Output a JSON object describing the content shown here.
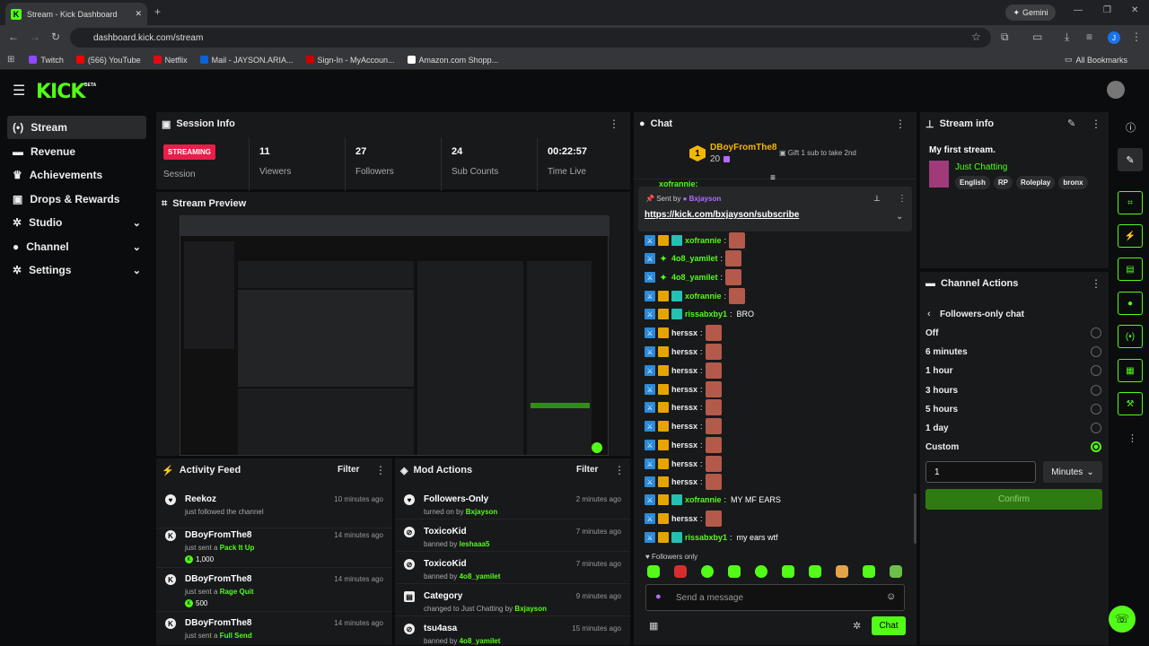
{
  "browser": {
    "tab_title": "Stream - Kick Dashboard",
    "url": "dashboard.kick.com/stream",
    "gemini": "Gemini",
    "bookmarks": [
      "Twitch",
      "(566) YouTube",
      "Netflix",
      "Mail - JAYSON.ARIA...",
      "Sign-In - MyAccoun...",
      "Amazon.com Shopp..."
    ],
    "all_bookmarks": "All Bookmarks"
  },
  "logo": {
    "text": "KICK",
    "badge": "BETA"
  },
  "sidebar": [
    {
      "label": "Stream",
      "icon": "broadcast-icon"
    },
    {
      "label": "Revenue",
      "icon": "money-icon"
    },
    {
      "label": "Achievements",
      "icon": "trophy-icon"
    },
    {
      "label": "Drops & Rewards",
      "icon": "gift-icon"
    },
    {
      "label": "Studio",
      "icon": "gear-icon"
    },
    {
      "label": "Channel",
      "icon": "user-icon"
    },
    {
      "label": "Settings",
      "icon": "gear-icon"
    }
  ],
  "session": {
    "title": "Session Info",
    "status": "STREAMING",
    "status_label": "Session",
    "stats": [
      {
        "v": "11",
        "l": "Viewers"
      },
      {
        "v": "27",
        "l": "Followers"
      },
      {
        "v": "24",
        "l": "Sub Counts"
      },
      {
        "v": "00:22:57",
        "l": "Time Live"
      }
    ]
  },
  "preview": {
    "title": "Stream Preview"
  },
  "activity": {
    "title": "Activity Feed",
    "filter": "Filter",
    "items": [
      {
        "name": "Reekoz",
        "sub": "just followed the channel",
        "hl": "",
        "time": "10 minutes ago",
        "extra": ""
      },
      {
        "name": "DBoyFromThe8",
        "sub": "just sent a",
        "hl": "Pack It Up",
        "time": "14 minutes ago",
        "extra": "1,000"
      },
      {
        "name": "DBoyFromThe8",
        "sub": "just sent a",
        "hl": "Rage Quit",
        "time": "14 minutes ago",
        "extra": "500"
      },
      {
        "name": "DBoyFromThe8",
        "sub": "just sent a",
        "hl": "Full Send",
        "time": "14 minutes ago",
        "extra": ""
      }
    ]
  },
  "mod": {
    "title": "Mod Actions",
    "filter": "Filter",
    "items": [
      {
        "name": "Followers-Only",
        "sub": "turned on by",
        "hl": "Bxjayson",
        "time": "2 minutes ago"
      },
      {
        "name": "ToxicoKid",
        "sub": "banned by",
        "hl": "leshaaa5",
        "time": "7 minutes ago"
      },
      {
        "name": "ToxicoKid",
        "sub": "banned by",
        "hl": "4o8_yamilet",
        "time": "7 minutes ago"
      },
      {
        "name": "Category",
        "sub": "changed to Just Chatting by",
        "hl": "Bxjayson",
        "time": "9 minutes ago"
      },
      {
        "name": "tsu4asa",
        "sub": "banned by",
        "hl": "4o8_yamilet",
        "time": "15 minutes ago"
      }
    ]
  },
  "chat": {
    "title": "Chat",
    "top_user": "DBoyFromThe8",
    "top_count": "20",
    "rank": "1",
    "gift_text": "Gift 1 sub to take 2nd",
    "pinned_by_label": "Sent by",
    "pinned_by": "Bxjayson",
    "pinned_link": "https://kick.com/bxjayson/subscribe",
    "partial_top": "xofrannie:",
    "lines": [
      {
        "u": "xofrannie",
        "c": "#53fc18",
        "msg": "",
        "emote": true,
        "b": "123"
      },
      {
        "u": "4o8_yamilet",
        "c": "#53fc18",
        "msg": "",
        "emote": true,
        "b": "14"
      },
      {
        "u": "4o8_yamilet",
        "c": "#53fc18",
        "msg": "",
        "emote": true,
        "b": "14"
      },
      {
        "u": "xofrannie",
        "c": "#53fc18",
        "msg": "",
        "emote": true,
        "b": "123"
      },
      {
        "u": "rissabxby1",
        "c": "#53fc18",
        "msg": "BRO",
        "emote": false,
        "b": "123"
      },
      {
        "u": "herssx",
        "c": "#eee",
        "msg": "",
        "emote": true,
        "b": "12"
      },
      {
        "u": "herssx",
        "c": "#eee",
        "msg": "",
        "emote": true,
        "b": "12"
      },
      {
        "u": "herssx",
        "c": "#eee",
        "msg": "",
        "emote": true,
        "b": "12"
      },
      {
        "u": "herssx",
        "c": "#eee",
        "msg": "",
        "emote": true,
        "b": "12"
      },
      {
        "u": "herssx",
        "c": "#eee",
        "msg": "",
        "emote": true,
        "b": "12"
      },
      {
        "u": "herssx",
        "c": "#eee",
        "msg": "",
        "emote": true,
        "b": "12"
      },
      {
        "u": "herssx",
        "c": "#eee",
        "msg": "",
        "emote": true,
        "b": "12"
      },
      {
        "u": "herssx",
        "c": "#eee",
        "msg": "",
        "emote": true,
        "b": "12"
      },
      {
        "u": "herssx",
        "c": "#eee",
        "msg": "",
        "emote": true,
        "b": "12"
      },
      {
        "u": "xofrannie",
        "c": "#53fc18",
        "msg": "MY MF EARS",
        "emote": false,
        "b": "123"
      },
      {
        "u": "herssx",
        "c": "#eee",
        "msg": "",
        "emote": true,
        "b": "12"
      },
      {
        "u": "rissabxby1",
        "c": "#53fc18",
        "msg": "my ears wtf",
        "emote": false,
        "b": "123"
      }
    ],
    "mode": "Followers only",
    "placeholder": "Send a message",
    "send": "Chat"
  },
  "stream_info": {
    "title": "Stream info",
    "stream_title": "My first stream.",
    "category": "Just Chatting",
    "tags": [
      "English",
      "RP",
      "Roleplay",
      "bronx"
    ]
  },
  "channel_actions": {
    "title": "Channel Actions",
    "sub": "Followers-only chat",
    "options": [
      "Off",
      "6 minutes",
      "1 hour",
      "3 hours",
      "5 hours",
      "1 day",
      "Custom"
    ],
    "selected": 6,
    "value": "1",
    "unit": "Minutes",
    "confirm": "Confirm"
  }
}
